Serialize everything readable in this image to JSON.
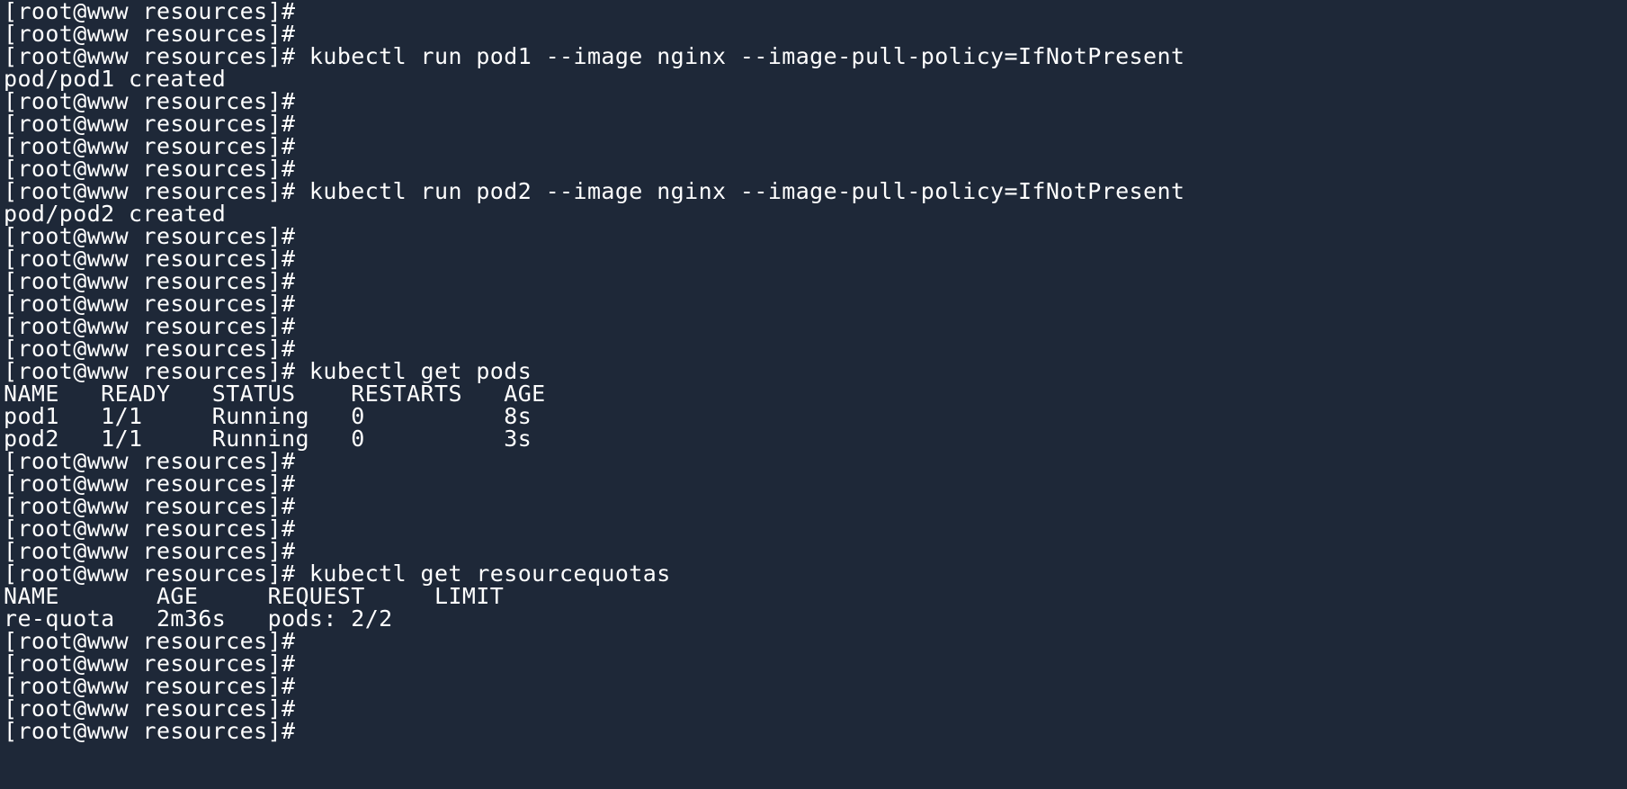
{
  "terminal": {
    "lines": [
      "[root@www resources]#",
      "[root@www resources]#",
      "[root@www resources]# kubectl run pod1 --image nginx --image-pull-policy=IfNotPresent",
      "pod/pod1 created",
      "[root@www resources]#",
      "[root@www resources]#",
      "[root@www resources]#",
      "[root@www resources]#",
      "[root@www resources]# kubectl run pod2 --image nginx --image-pull-policy=IfNotPresent",
      "pod/pod2 created",
      "[root@www resources]#",
      "[root@www resources]#",
      "[root@www resources]#",
      "[root@www resources]#",
      "[root@www resources]#",
      "[root@www resources]#",
      "[root@www resources]# kubectl get pods",
      "NAME   READY   STATUS    RESTARTS   AGE",
      "pod1   1/1     Running   0          8s",
      "pod2   1/1     Running   0          3s",
      "[root@www resources]#",
      "[root@www resources]#",
      "[root@www resources]#",
      "[root@www resources]#",
      "[root@www resources]#",
      "[root@www resources]# kubectl get resourcequotas",
      "NAME       AGE     REQUEST     LIMIT",
      "re-quota   2m36s   pods: 2/2",
      "[root@www resources]#",
      "[root@www resources]#",
      "[root@www resources]#",
      "[root@www resources]#",
      "[root@www resources]#"
    ]
  }
}
